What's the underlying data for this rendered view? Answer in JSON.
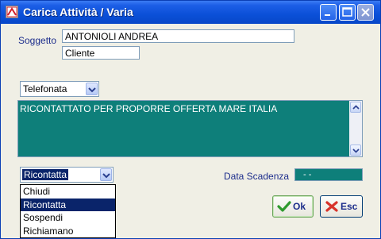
{
  "window": {
    "title": "Carica Attività / Varia"
  },
  "form": {
    "soggetto_label": "Soggetto",
    "soggetto_value": "ANTONIOLI ANDREA",
    "tipo_soggetto": "Cliente",
    "tipo_attivita": "Telefonata",
    "note": "RICONTATTATO PER PROPORRE OFFERTA MARE ITALIA",
    "stato_selected": "Ricontatta",
    "stato_options": [
      "Chiudi",
      "Ricontatta",
      "Sospendi",
      "Richiamano"
    ],
    "data_scadenza_label": "Data Scadenza",
    "data_scadenza_value": "- -"
  },
  "buttons": {
    "ok_label": "Ok",
    "esc_label": "Esc"
  },
  "colors": {
    "accent_teal": "#0e7f7a",
    "selection": "#0a246a",
    "label_blue": "#1c2d8c"
  }
}
